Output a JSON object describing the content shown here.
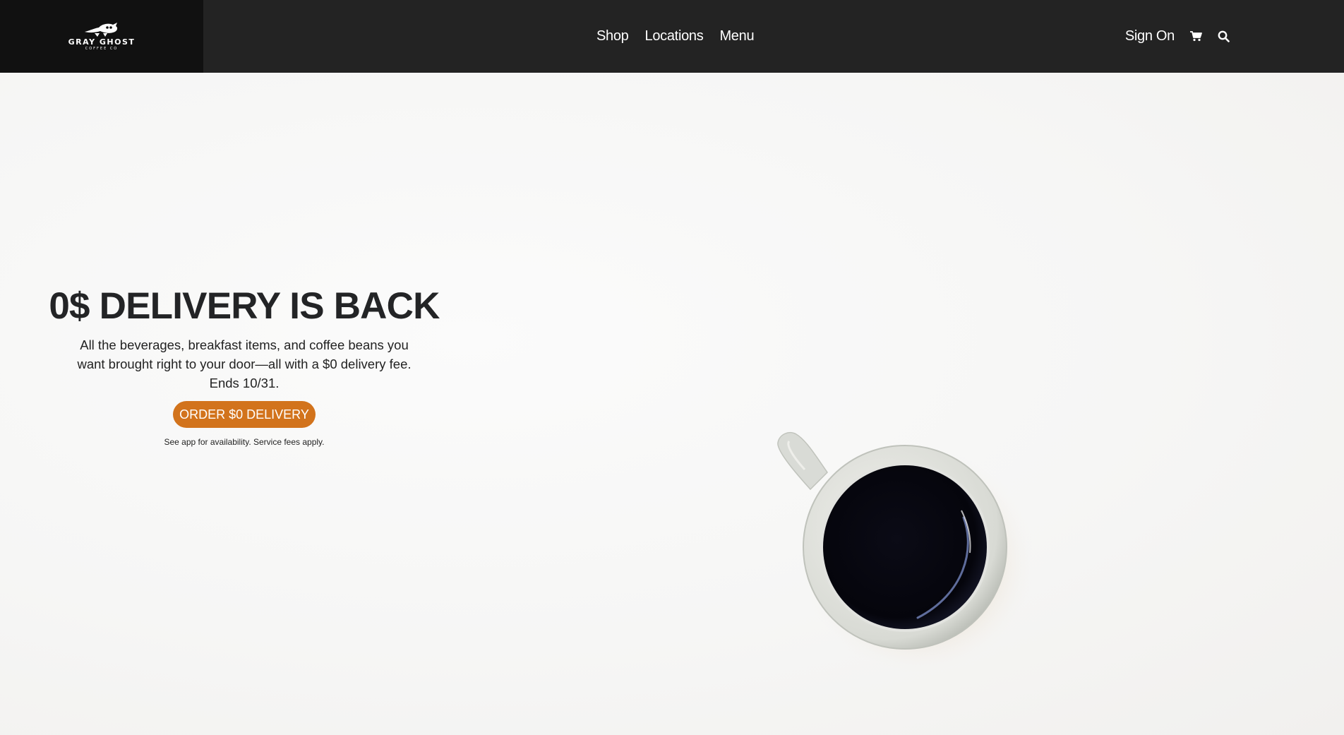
{
  "header": {
    "logo": {
      "name": "GRAY GHOST",
      "subtitle": "COFFEE CO"
    },
    "nav": {
      "shop": "Shop",
      "locations": "Locations",
      "menu": "Menu"
    },
    "sign_on": "Sign On",
    "icons": [
      "cart-icon",
      "search-icon"
    ]
  },
  "hero": {
    "title": "0$ DELIVERY IS BACK",
    "body": "All the beverages, breakfast items, and coffee beans you want brought right to your door—all with a $0 delivery fee. Ends 10/31.",
    "cta_label": "ORDER $0 DELIVERY",
    "disclaimer": "See app for availability. Service fees apply."
  },
  "colors": {
    "nav_bg": "#232323",
    "logo_bg": "#111111",
    "accent": "#d2731c",
    "hero_bg": "#f7f7f6",
    "title_text": "#232426"
  }
}
